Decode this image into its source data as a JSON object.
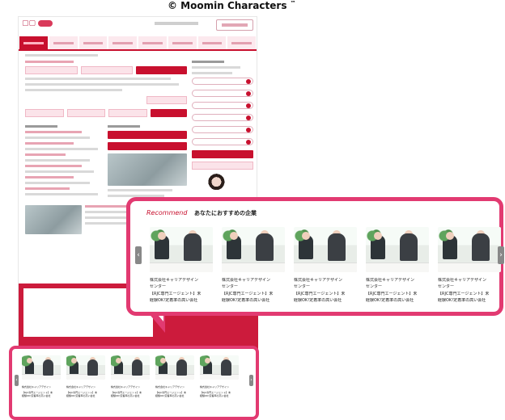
{
  "copyright": {
    "text": "© Moomin Characters",
    "tm": "™"
  },
  "recommend": {
    "title_en": "Recommend",
    "title_jp": "あなたにおすすめの企業",
    "cards": [
      {
        "company": "株式会社キャリアデザイン",
        "company2": "センター",
        "desc": "【RJC専門エージェント】未",
        "desc2": "経験OK!定着率の高い会社"
      },
      {
        "company": "株式会社キャリアデザイン",
        "company2": "センター",
        "desc": "【RJC専門エージェント】未",
        "desc2": "経験OK!定着率の高い会社"
      },
      {
        "company": "株式会社キャリアデザイン",
        "company2": "センター",
        "desc": "【RJC専門エージェント】未",
        "desc2": "経験OK!定着率の高い会社"
      },
      {
        "company": "株式会社キャリアデザイン",
        "company2": "センター",
        "desc": "【RJC専門エージェント】未",
        "desc2": "経験OK!定着率の高い会社"
      },
      {
        "company": "株式会社キャリアデザイン",
        "company2": "センター",
        "desc": "【RJC専門エージェント】未",
        "desc2": "経験OK!定着率の高い会社"
      }
    ],
    "prev_icon": "‹",
    "next_icon": "›"
  },
  "colors": {
    "accent": "#c8102e",
    "callout_border": "#e23a71"
  }
}
